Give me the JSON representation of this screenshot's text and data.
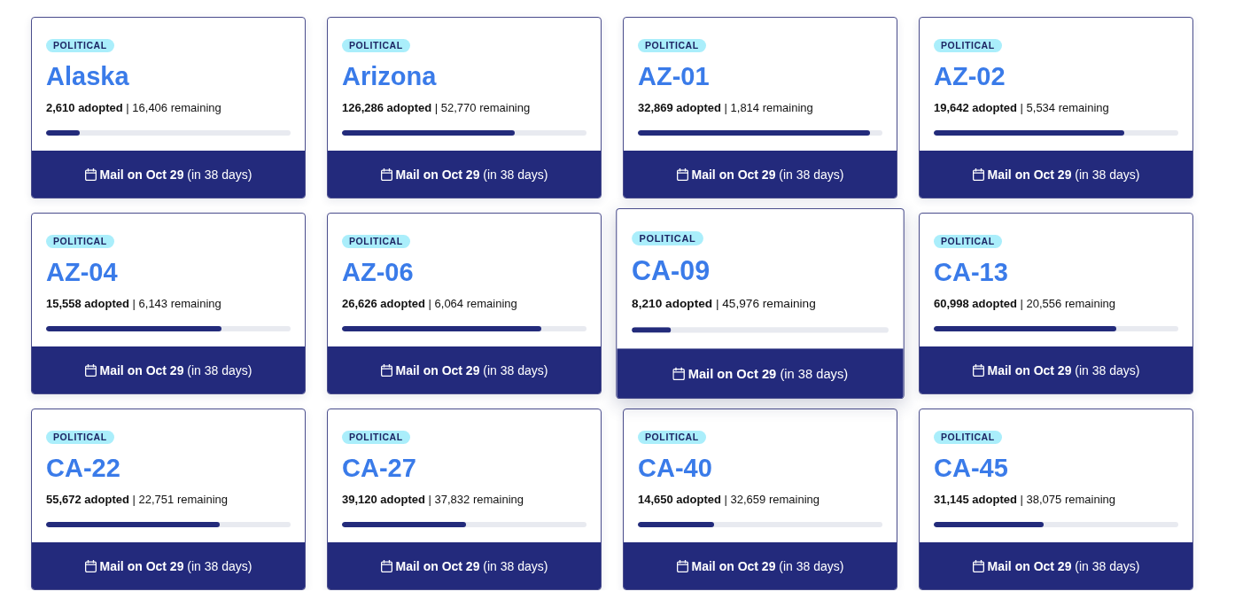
{
  "cards": [
    {
      "tag": "POLITICAL",
      "title": "Alaska",
      "stats": "**2,610 adopted** | 16,406 remaining",
      "level": 0.137,
      "mail": "**Mail on Oct 29** (in 38 days)",
      "highlighted": false
    },
    {
      "tag": "POLITICAL",
      "title": "Arizona",
      "stats": "**126,286 adopted** | 52,770 remaining",
      "level": 0.705,
      "mail": "**Mail on Oct 29** (in 38 days)",
      "highlighted": false
    },
    {
      "tag": "POLITICAL",
      "title": "AZ-01",
      "stats": "**32,869 adopted** | 1,814 remaining",
      "level": 0.948,
      "mail": "**Mail on Oct 29** (in 38 days)",
      "highlighted": false
    },
    {
      "tag": "POLITICAL",
      "title": "AZ-02",
      "stats": "**19,642 adopted** | 5,534 remaining",
      "level": 0.78,
      "mail": "**Mail on Oct 29** (in 38 days)",
      "highlighted": false
    },
    {
      "tag": "POLITICAL",
      "title": "AZ-04",
      "stats": "**15,558 adopted** | 6,143 remaining",
      "level": 0.717,
      "mail": "**Mail on Oct 29** (in 38 days)",
      "highlighted": false
    },
    {
      "tag": "POLITICAL",
      "title": "AZ-06",
      "stats": "**26,626 adopted** | 6,064 remaining",
      "level": 0.815,
      "mail": "**Mail on Oct 29** (in 38 days)",
      "highlighted": false
    },
    {
      "tag": "POLITICAL",
      "title": "CA-09",
      "stats": "**8,210 adopted** | 45,976 remaining",
      "level": 0.152,
      "mail": "**Mail on Oct 29** (in 38 days)",
      "highlighted": true
    },
    {
      "tag": "POLITICAL",
      "title": "CA-13",
      "stats": "**60,998 adopted** | 20,556 remaining",
      "level": 0.748,
      "mail": "**Mail on Oct 29** (in 38 days)",
      "highlighted": false
    },
    {
      "tag": "POLITICAL",
      "title": "CA-22",
      "stats": "**55,672 adopted** | 22,751 remaining",
      "level": 0.71,
      "mail": "**Mail on Oct 29** (in 38 days)",
      "highlighted": false
    },
    {
      "tag": "POLITICAL",
      "title": "CA-27",
      "stats": "**39,120 adopted** | 37,832 remaining",
      "level": 0.508,
      "mail": "**Mail on Oct 29** (in 38 days)",
      "highlighted": false
    },
    {
      "tag": "POLITICAL",
      "title": "CA-40",
      "stats": "**14,650 adopted** | 32,659 remaining",
      "level": 0.31,
      "mail": "**Mail on Oct 29** (in 38 days)",
      "highlighted": false
    },
    {
      "tag": "POLITICAL",
      "title": "CA-45",
      "stats": "**31,145 adopted** | 38,075 remaining",
      "level": 0.45,
      "mail": "**Mail on Oct 29** (in 38 days)",
      "highlighted": false
    }
  ]
}
